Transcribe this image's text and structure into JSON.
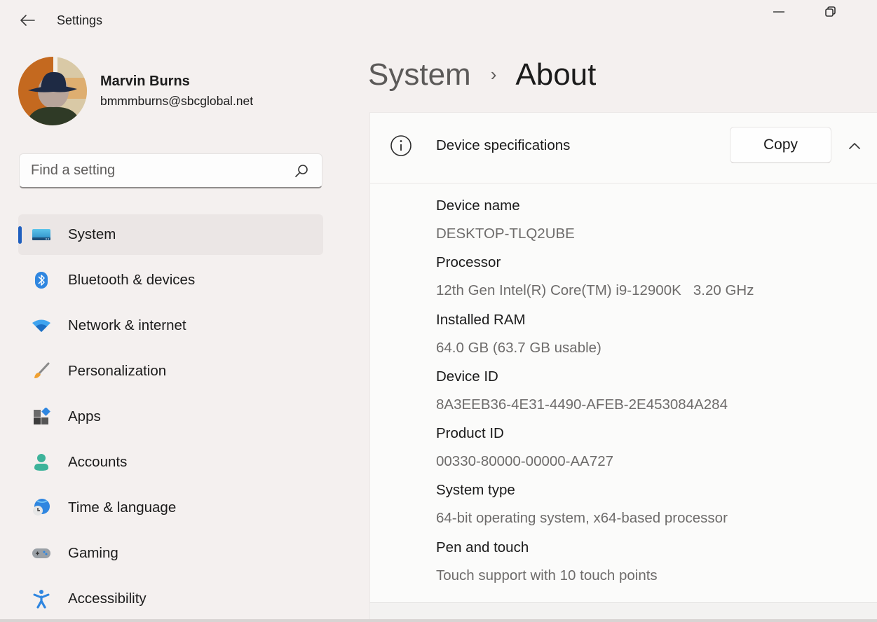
{
  "window": {
    "title": "Settings",
    "back_icon": "arrow-left-icon",
    "minimize_icon": "minimize-icon",
    "restore_icon": "restore-icon"
  },
  "profile": {
    "name": "Marvin Burns",
    "email": "bmmmburns@sbcglobal.net"
  },
  "search": {
    "placeholder": "Find a setting",
    "value": "",
    "icon": "search-icon"
  },
  "sidebar": {
    "accent_color": "#1f5fbf",
    "items": [
      {
        "label": "System",
        "icon": "system-display-icon",
        "active": true
      },
      {
        "label": "Bluetooth & devices",
        "icon": "bluetooth-icon",
        "active": false
      },
      {
        "label": "Network & internet",
        "icon": "wifi-icon",
        "active": false
      },
      {
        "label": "Personalization",
        "icon": "paintbrush-icon",
        "active": false
      },
      {
        "label": "Apps",
        "icon": "apps-icon",
        "active": false
      },
      {
        "label": "Accounts",
        "icon": "person-icon",
        "active": false
      },
      {
        "label": "Time & language",
        "icon": "globe-clock-icon",
        "active": false
      },
      {
        "label": "Gaming",
        "icon": "gamepad-icon",
        "active": false
      },
      {
        "label": "Accessibility",
        "icon": "accessibility-icon",
        "active": false
      }
    ]
  },
  "breadcrumb": {
    "parent": "System",
    "separator": "›",
    "current": "About"
  },
  "device_specs": {
    "title": "Device specifications",
    "icon": "info-icon",
    "copy_label": "Copy",
    "expanded": true,
    "items": [
      {
        "label": "Device name",
        "value": "DESKTOP-TLQ2UBE"
      },
      {
        "label": "Processor",
        "value": "12th Gen Intel(R) Core(TM) i9-12900K   3.20 GHz"
      },
      {
        "label": "Installed RAM",
        "value": "64.0 GB (63.7 GB usable)"
      },
      {
        "label": "Device ID",
        "value": "8A3EEB36-4E31-4490-AFEB-2E453084A284"
      },
      {
        "label": "Product ID",
        "value": "00330-80000-00000-AA727"
      },
      {
        "label": "System type",
        "value": "64-bit operating system, x64-based processor"
      },
      {
        "label": "Pen and touch",
        "value": "Touch support with 10 touch points"
      }
    ]
  }
}
